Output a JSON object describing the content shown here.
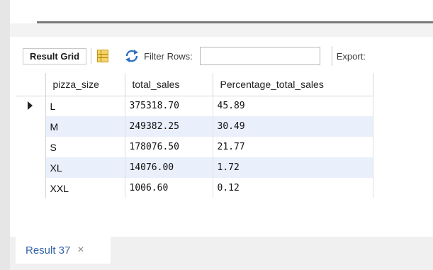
{
  "toolbar": {
    "result_grid_label": "Result Grid",
    "filter_rows_label": "Filter Rows:",
    "filter_rows_value": "",
    "export_label": "Export:"
  },
  "grid": {
    "columns": [
      "pizza_size",
      "total_sales",
      "Percentage_total_sales"
    ],
    "rows": [
      {
        "pizza_size": "L",
        "total_sales": "375318.70",
        "percentage": "45.89"
      },
      {
        "pizza_size": "M",
        "total_sales": "249382.25",
        "percentage": "30.49"
      },
      {
        "pizza_size": "S",
        "total_sales": "178076.50",
        "percentage": "21.77"
      },
      {
        "pizza_size": "XL",
        "total_sales": "14076.00",
        "percentage": "1.72"
      },
      {
        "pizza_size": "XXL",
        "total_sales": "1006.60",
        "percentage": "0.12"
      }
    ]
  },
  "tabs": {
    "result_tab_label": "Result 37",
    "close_glyph": "×"
  },
  "icons": {
    "grid_view": "grid-view-icon",
    "refresh": "refresh-icon",
    "current_row": "row-pointer-icon",
    "close": "close-icon"
  },
  "colors": {
    "alt_row": "#e9effb",
    "tab_text": "#3563a8",
    "splitter": "#7a7a7a"
  }
}
